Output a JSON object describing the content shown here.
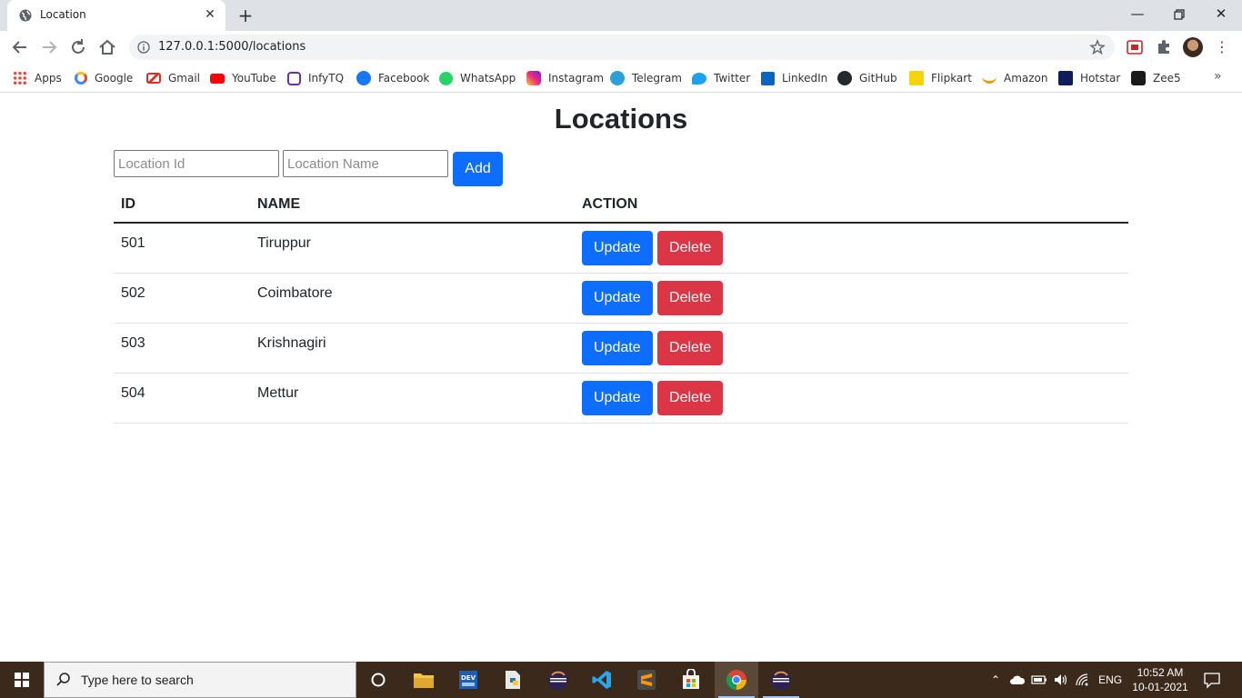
{
  "browser": {
    "tab_title": "Location",
    "url": "127.0.0.1:5000/locations",
    "bookmarks": [
      {
        "label": "Apps",
        "color": "#4285f4"
      },
      {
        "label": "Google",
        "color": "#ea4335"
      },
      {
        "label": "Gmail",
        "color": "#d93025"
      },
      {
        "label": "YouTube",
        "color": "#ff0000"
      },
      {
        "label": "InfyTQ",
        "color": "#6b2fa3"
      },
      {
        "label": "Facebook",
        "color": "#1877f2"
      },
      {
        "label": "WhatsApp",
        "color": "#25d366"
      },
      {
        "label": "Instagram",
        "color": "#c13584"
      },
      {
        "label": "Telegram",
        "color": "#2aa1da"
      },
      {
        "label": "Twitter",
        "color": "#1da1f2"
      },
      {
        "label": "LinkedIn",
        "color": "#0a66c2"
      },
      {
        "label": "GitHub",
        "color": "#24292e"
      },
      {
        "label": "Flipkart",
        "color": "#f8d30d"
      },
      {
        "label": "Amazon",
        "color": "#ff9900"
      },
      {
        "label": "Hotstar",
        "color": "#0f1e5a"
      },
      {
        "label": "Zee5",
        "color": "#1a1a1a"
      }
    ]
  },
  "page": {
    "title": "Locations",
    "form": {
      "id_placeholder": "Location Id",
      "name_placeholder": "Location Name",
      "add_label": "Add"
    },
    "table": {
      "headers": [
        "ID",
        "NAME",
        "ACTION"
      ],
      "rows": [
        {
          "id": "501",
          "name": "Tiruppur"
        },
        {
          "id": "502",
          "name": "Coimbatore"
        },
        {
          "id": "503",
          "name": "Krishnagiri"
        },
        {
          "id": "504",
          "name": "Mettur"
        }
      ],
      "update_label": "Update",
      "delete_label": "Delete"
    },
    "colors": {
      "primary": "#0d6efd",
      "danger": "#dc3545"
    }
  },
  "taskbar": {
    "search_placeholder": "Type here to search",
    "language": "ENG",
    "time": "10:52 AM",
    "date": "10-01-2021"
  }
}
